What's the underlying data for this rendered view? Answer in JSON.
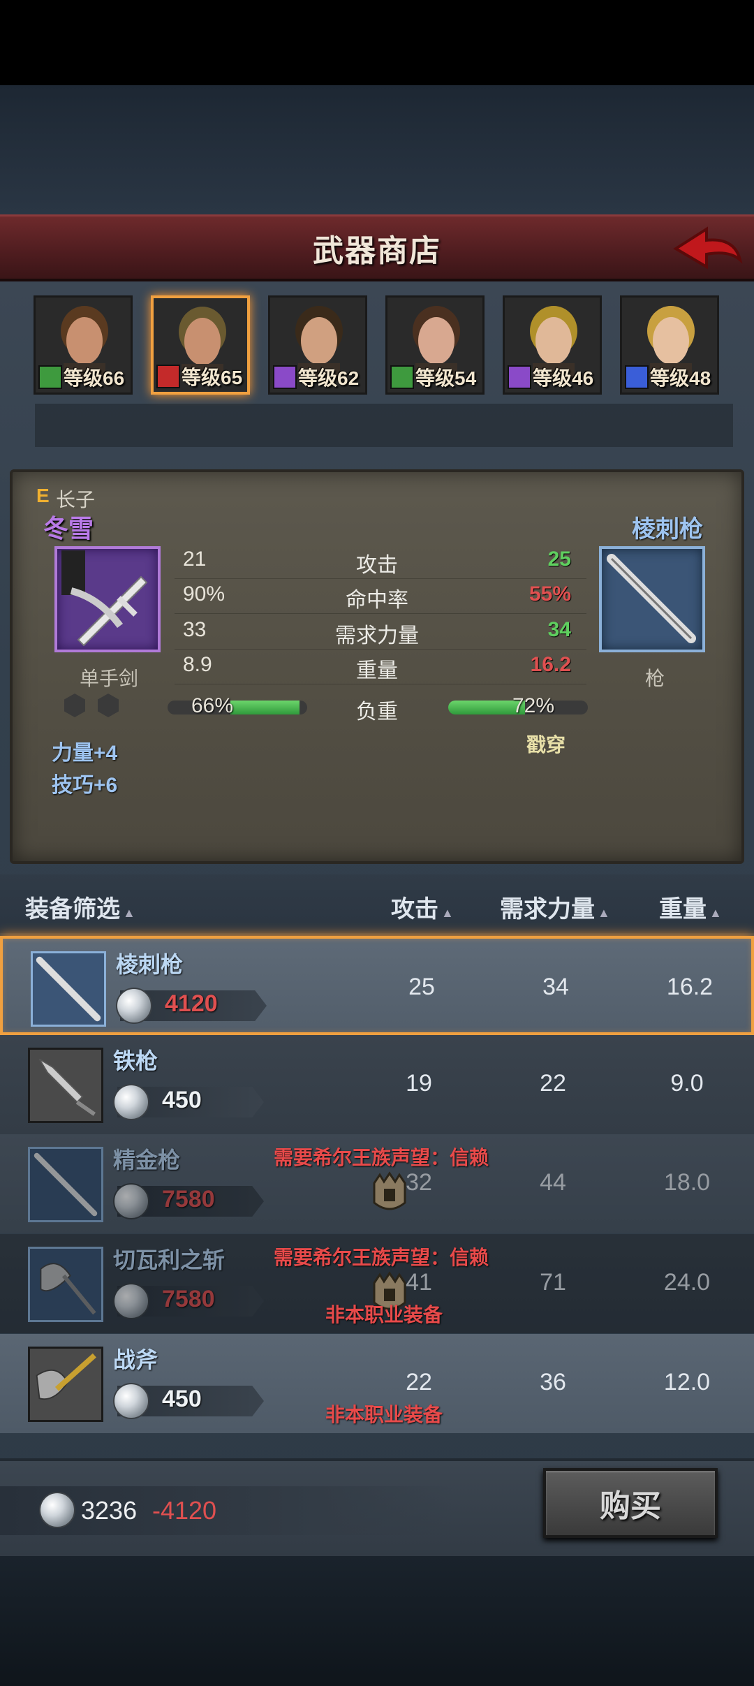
{
  "header": {
    "title": "武器商店"
  },
  "party": [
    {
      "level_text": "等级66",
      "class_color": "#3e9a3e",
      "class_icon": "bow-icon"
    },
    {
      "level_text": "等级65",
      "class_color": "#c42a2a",
      "class_icon": "horse-icon"
    },
    {
      "level_text": "等级62",
      "class_color": "#8a4ac8",
      "class_icon": "staff-icon"
    },
    {
      "level_text": "等级54",
      "class_color": "#3e9a3e",
      "class_icon": "bow-icon"
    },
    {
      "level_text": "等级46",
      "class_color": "#8a4ac8",
      "class_icon": "staff-icon"
    },
    {
      "level_text": "等级48",
      "class_color": "#3a5ed8",
      "class_icon": "sword-icon"
    }
  ],
  "compare": {
    "rank": "E",
    "role": "长子",
    "name": "冬雪",
    "current_weapon_type": "单手剑",
    "bonuses": [
      "力量+4",
      "技巧+6"
    ],
    "new_weapon_name": "棱刺枪",
    "new_weapon_type": "枪",
    "damage_type": "戳穿",
    "stats": [
      {
        "label": "攻击",
        "current": "21",
        "new": "25",
        "new_color": "#5fcf5f"
      },
      {
        "label": "命中率",
        "current": "90%",
        "new": "55%",
        "new_color": "#e05050"
      },
      {
        "label": "需求力量",
        "current": "33",
        "new": "34",
        "new_color": "#5fcf5f"
      },
      {
        "label": "重量",
        "current": "8.9",
        "new": "16.2",
        "new_color": "#e05050"
      }
    ],
    "load": {
      "label": "负重",
      "current": "66%",
      "new": "72%",
      "current_fraction": 0.66,
      "new_fraction": 0.72
    }
  },
  "list_header": {
    "filter": "装备筛选",
    "attack": "攻击",
    "str_req": "需求力量",
    "weight": "重量"
  },
  "items": [
    {
      "name": "棱刺枪",
      "price": "4120",
      "price_color": "red",
      "attack": "25",
      "str_req": "34",
      "weight": "16.2",
      "selected": true
    },
    {
      "name": "铁枪",
      "price": "450",
      "price_color": "white",
      "attack": "19",
      "str_req": "22",
      "weight": "9.0"
    },
    {
      "name": "精金枪",
      "price": "7580",
      "price_color": "red",
      "attack": "32",
      "str_req": "44",
      "weight": "18.0",
      "requirement": "需要希尔王族声望：信赖",
      "locked": true
    },
    {
      "name": "切瓦利之斩",
      "price": "7580",
      "price_color": "red",
      "attack": "41",
      "str_req": "71",
      "weight": "24.0",
      "requirement": "需要希尔王族声望：信赖",
      "locked": true,
      "class_warning": "非本职业装备"
    },
    {
      "name": "战斧",
      "price": "450",
      "price_color": "white",
      "attack": "22",
      "str_req": "36",
      "weight": "12.0",
      "class_warning": "非本职业装备"
    }
  ],
  "footer": {
    "gold": "3236",
    "cost": "-4120",
    "buy_label": "购买"
  }
}
